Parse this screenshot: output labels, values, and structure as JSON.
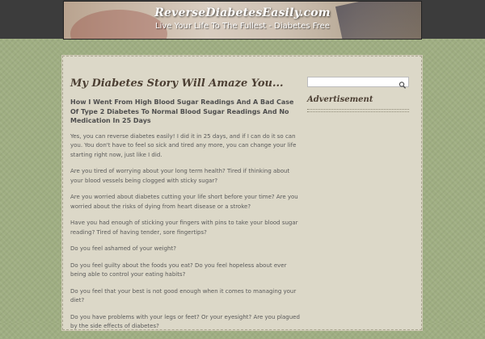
{
  "header": {
    "site_title": "ReverseDiabetesEasily.com",
    "tagline": "Live Your Life To The Fullest - Diabetes Free"
  },
  "post": {
    "title": "My Diabetes Story Will Amaze You...",
    "subtitle": "How I Went From High Blood Sugar Readings And A Bad Case Of Type 2 Diabetes To Normal Blood Sugar Readings And No Medication In 25 Days",
    "paragraphs": [
      "Yes, you can reverse diabetes easily! I did it in 25 days, and if I can do it so can you. You don't have to feel so sick and tired any more, you can change your life starting right now, just like I did.",
      "Are you tired of worrying about your long term health? Tired if thinking about your blood vessels being clogged with sticky sugar?",
      "Are you worried about diabetes cutting your life short before your time? Are you worried about the risks of dying from heart disease or a stroke?",
      "Have you had enough of sticking your fingers with pins to take your blood sugar reading? Tired of having tender, sore fingertips?",
      "Do you feel ashamed of your weight?",
      "Do you feel guilty about the foods you eat?   Do you feel hopeless about ever being able to control your eating habits?",
      "Do you feel that your best is not good enough when it comes to managing your diet?",
      "Do you have problems with your legs or feet? Or your eyesight? Are you plagued by the side effects of diabetes?"
    ]
  },
  "sidebar": {
    "search": {
      "value": "",
      "placeholder": ""
    },
    "widget_title": "Advertisement"
  },
  "colors": {
    "page_background": "#9fae82",
    "top_bar": "#3c3c3c",
    "content_background": "#dcd8c8",
    "heading": "#4c3f33",
    "body_text": "#5a5a5a"
  },
  "icons": {
    "search": "magnifier-icon"
  }
}
